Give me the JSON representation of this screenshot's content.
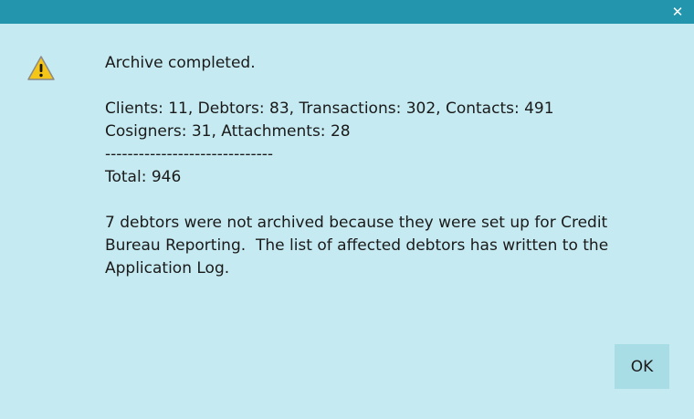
{
  "window": {
    "close_glyph": "✕",
    "title_bar_color": "#2396ae",
    "background_color": "#c5eaf1"
  },
  "icon": {
    "name": "warning-icon"
  },
  "message": {
    "heading": "Archive completed.",
    "counts_line1": "Clients: 11, Debtors: 83, Transactions: 302, Contacts: 491",
    "counts_line2": "Cosigners: 31, Attachments: 28",
    "separator": "------------------------------",
    "total": "Total: 946",
    "note_line1": "7 debtors were not archived because they were set up for Credit",
    "note_line2": "Bureau Reporting.  The list of affected debtors has written to the",
    "note_line3": "Application Log."
  },
  "buttons": {
    "ok_label": "OK"
  }
}
